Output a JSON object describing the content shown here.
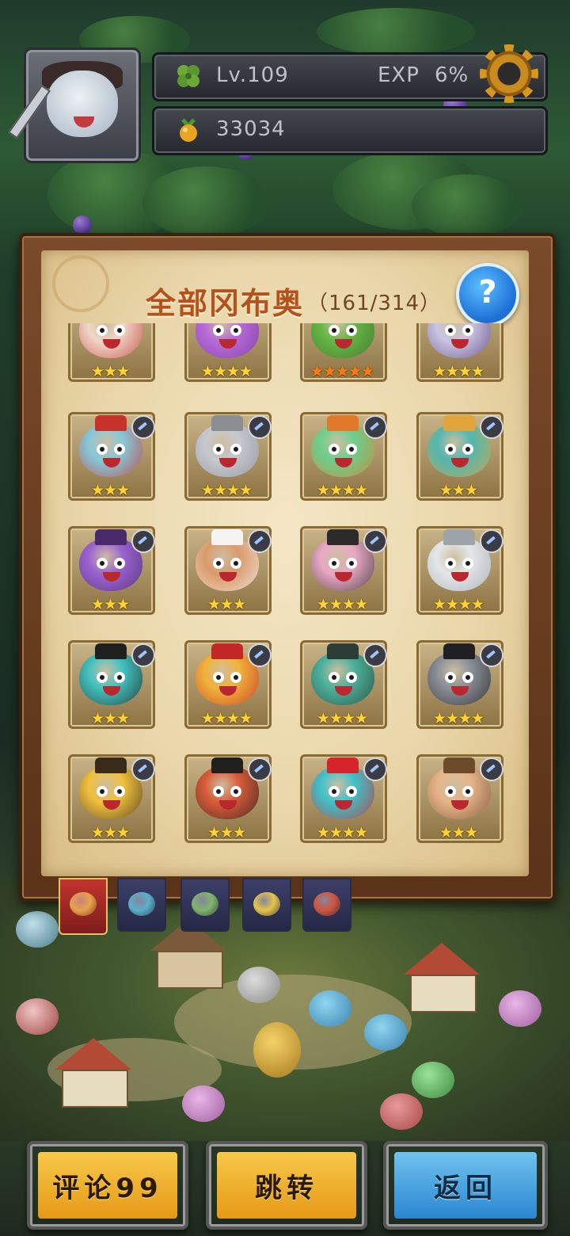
{
  "hud": {
    "level": "Lv.109",
    "exp_label": "EXP",
    "exp_value": "6%",
    "currency": "33034",
    "level_icon": "clover-icon",
    "currency_icon": "fruit-icon",
    "settings_icon": "gear-icon"
  },
  "collection": {
    "title": "全部冈布奥",
    "count": "（161/314）",
    "help_label": "?"
  },
  "cards": [
    {
      "stars": "★★★",
      "color": "#f0d7c9",
      "accent": "#c2372f"
    },
    {
      "stars": "★★★★",
      "color": "#b76bd6",
      "accent": "#7a3aa0"
    },
    {
      "stars": "★★★★★",
      "color": "#66b645",
      "accent": "#3d6c2b",
      "star_color": "red"
    },
    {
      "stars": "★★★★",
      "color": "#c9c6e2",
      "accent": "#5a3a7a"
    },
    {
      "stars": "★★★",
      "color": "#86c8d8",
      "accent": "#c7322c"
    },
    {
      "stars": "★★★★",
      "color": "#c6c8cf",
      "accent": "#8d8e94"
    },
    {
      "stars": "★★★★",
      "color": "#6ccf8d",
      "accent": "#e07a2a"
    },
    {
      "stars": "★★★",
      "color": "#52b7b0",
      "accent": "#e0a43a"
    },
    {
      "stars": "★★★",
      "color": "#9a63d0",
      "accent": "#4a2a6a"
    },
    {
      "stars": "★★★",
      "color": "#d99a6a",
      "accent": "#f4f4f4"
    },
    {
      "stars": "★★★★",
      "color": "#e9a8c4",
      "accent": "#2b2b2b"
    },
    {
      "stars": "★★★★",
      "color": "#e4e6e9",
      "accent": "#9fa3aa"
    },
    {
      "stars": "★★★",
      "color": "#42c2c0",
      "accent": "#1f1f1f"
    },
    {
      "stars": "★★★★",
      "color": "#f0b33a",
      "accent": "#c42727"
    },
    {
      "stars": "★★★★",
      "color": "#4bb09a",
      "accent": "#2b3d36"
    },
    {
      "stars": "★★★★",
      "color": "#8b8f96",
      "accent": "#1f1f24"
    },
    {
      "stars": "★★★",
      "color": "#f1c03d",
      "accent": "#3a2a1a"
    },
    {
      "stars": "★★★",
      "color": "#d95b3a",
      "accent": "#1f1f1f"
    },
    {
      "stars": "★★★★",
      "color": "#3fc1c9",
      "accent": "#d6242a"
    },
    {
      "stars": "★★★",
      "color": "#e7b48a",
      "accent": "#6d4a2a"
    }
  ],
  "tabs": [
    {
      "name": "tab-all",
      "color": "#e7a34a"
    },
    {
      "name": "tab-blue",
      "color": "#5ab0c8"
    },
    {
      "name": "tab-green",
      "color": "#7fb56b"
    },
    {
      "name": "tab-yellow",
      "color": "#e6c44a"
    },
    {
      "name": "tab-red",
      "color": "#d0563e"
    }
  ],
  "buttons": {
    "comment": "评论99",
    "jump": "跳转",
    "back": "返回"
  }
}
